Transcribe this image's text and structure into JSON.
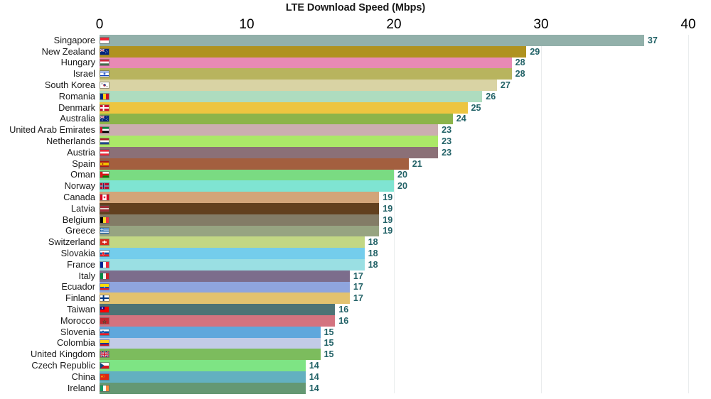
{
  "chart_data": {
    "type": "bar",
    "orientation": "horizontal",
    "title": "LTE Download Speed (Mbps)",
    "xlabel": "",
    "ylabel": "",
    "xlim": [
      0,
      40
    ],
    "xticks": [
      0,
      10,
      20,
      30,
      40
    ],
    "xtick_labels": [
      "0",
      "10",
      "20",
      "30",
      "40"
    ],
    "grid": true,
    "grid_axis": "x",
    "legend": "none",
    "value_label_color": "#226267",
    "categories": [
      "Singapore",
      "New Zealand",
      "Hungary",
      "Israel",
      "South Korea",
      "Romania",
      "Denmark",
      "Australia",
      "United Arab Emirates",
      "Netherlands",
      "Austria",
      "Spain",
      "Oman",
      "Norway",
      "Canada",
      "Latvia",
      "Belgium",
      "Greece",
      "Switzerland",
      "Slovakia",
      "France",
      "Italy",
      "Ecuador",
      "Finland",
      "Taiwan",
      "Morocco",
      "Slovenia",
      "Colombia",
      "United Kingdom",
      "Czech Republic",
      "China",
      "Ireland"
    ],
    "values": [
      37,
      29,
      28,
      28,
      27,
      26,
      25,
      24,
      23,
      23,
      23,
      21,
      20,
      20,
      19,
      19,
      19,
      19,
      18,
      18,
      18,
      17,
      17,
      17,
      16,
      16,
      15,
      15,
      15,
      14,
      14,
      14
    ],
    "bar_colors": [
      "#92b0aa",
      "#af921f",
      "#e88ab5",
      "#b8b45e",
      "#d9d3a4",
      "#aedcbf",
      "#edc540",
      "#8cb44a",
      "#cbaeb0",
      "#abe868",
      "#8b7077",
      "#a35f3f",
      "#7adb82",
      "#7fe4d2",
      "#d2a579",
      "#62401e",
      "#837c66",
      "#97a481",
      "#c2d784",
      "#74cdec",
      "#9adfe3",
      "#7c6d8c",
      "#8fa5de",
      "#e3c26f",
      "#4e7375",
      "#d4737f",
      "#5fa7dc",
      "#c2cbe6",
      "#7cbc5d",
      "#7ee484",
      "#63b0c0",
      "#649873"
    ]
  },
  "rows": [
    {
      "country": "Singapore",
      "value": "37",
      "flag": "singapore-flag"
    },
    {
      "country": "New Zealand",
      "value": "29",
      "flag": "new-zealand-flag"
    },
    {
      "country": "Hungary",
      "value": "28",
      "flag": "hungary-flag"
    },
    {
      "country": "Israel",
      "value": "28",
      "flag": "israel-flag"
    },
    {
      "country": "South Korea",
      "value": "27",
      "flag": "south-korea-flag"
    },
    {
      "country": "Romania",
      "value": "26",
      "flag": "romania-flag"
    },
    {
      "country": "Denmark",
      "value": "25",
      "flag": "denmark-flag"
    },
    {
      "country": "Australia",
      "value": "24",
      "flag": "australia-flag"
    },
    {
      "country": "United Arab Emirates",
      "value": "23",
      "flag": "uae-flag"
    },
    {
      "country": "Netherlands",
      "value": "23",
      "flag": "netherlands-flag"
    },
    {
      "country": "Austria",
      "value": "23",
      "flag": "austria-flag"
    },
    {
      "country": "Spain",
      "value": "21",
      "flag": "spain-flag"
    },
    {
      "country": "Oman",
      "value": "20",
      "flag": "oman-flag"
    },
    {
      "country": "Norway",
      "value": "20",
      "flag": "norway-flag"
    },
    {
      "country": "Canada",
      "value": "19",
      "flag": "canada-flag"
    },
    {
      "country": "Latvia",
      "value": "19",
      "flag": "latvia-flag"
    },
    {
      "country": "Belgium",
      "value": "19",
      "flag": "belgium-flag"
    },
    {
      "country": "Greece",
      "value": "19",
      "flag": "greece-flag"
    },
    {
      "country": "Switzerland",
      "value": "18",
      "flag": "switzerland-flag"
    },
    {
      "country": "Slovakia",
      "value": "18",
      "flag": "slovakia-flag"
    },
    {
      "country": "France",
      "value": "18",
      "flag": "france-flag"
    },
    {
      "country": "Italy",
      "value": "17",
      "flag": "italy-flag"
    },
    {
      "country": "Ecuador",
      "value": "17",
      "flag": "ecuador-flag"
    },
    {
      "country": "Finland",
      "value": "17",
      "flag": "finland-flag"
    },
    {
      "country": "Taiwan",
      "value": "16",
      "flag": "taiwan-flag"
    },
    {
      "country": "Morocco",
      "value": "16",
      "flag": "morocco-flag"
    },
    {
      "country": "Slovenia",
      "value": "15",
      "flag": "slovenia-flag"
    },
    {
      "country": "Colombia",
      "value": "15",
      "flag": "colombia-flag"
    },
    {
      "country": "United Kingdom",
      "value": "15",
      "flag": "united-kingdom-flag"
    },
    {
      "country": "Czech Republic",
      "value": "14",
      "flag": "czech-republic-flag"
    },
    {
      "country": "China",
      "value": "14",
      "flag": "china-flag"
    },
    {
      "country": "Ireland",
      "value": "14",
      "flag": "ireland-flag"
    }
  ]
}
